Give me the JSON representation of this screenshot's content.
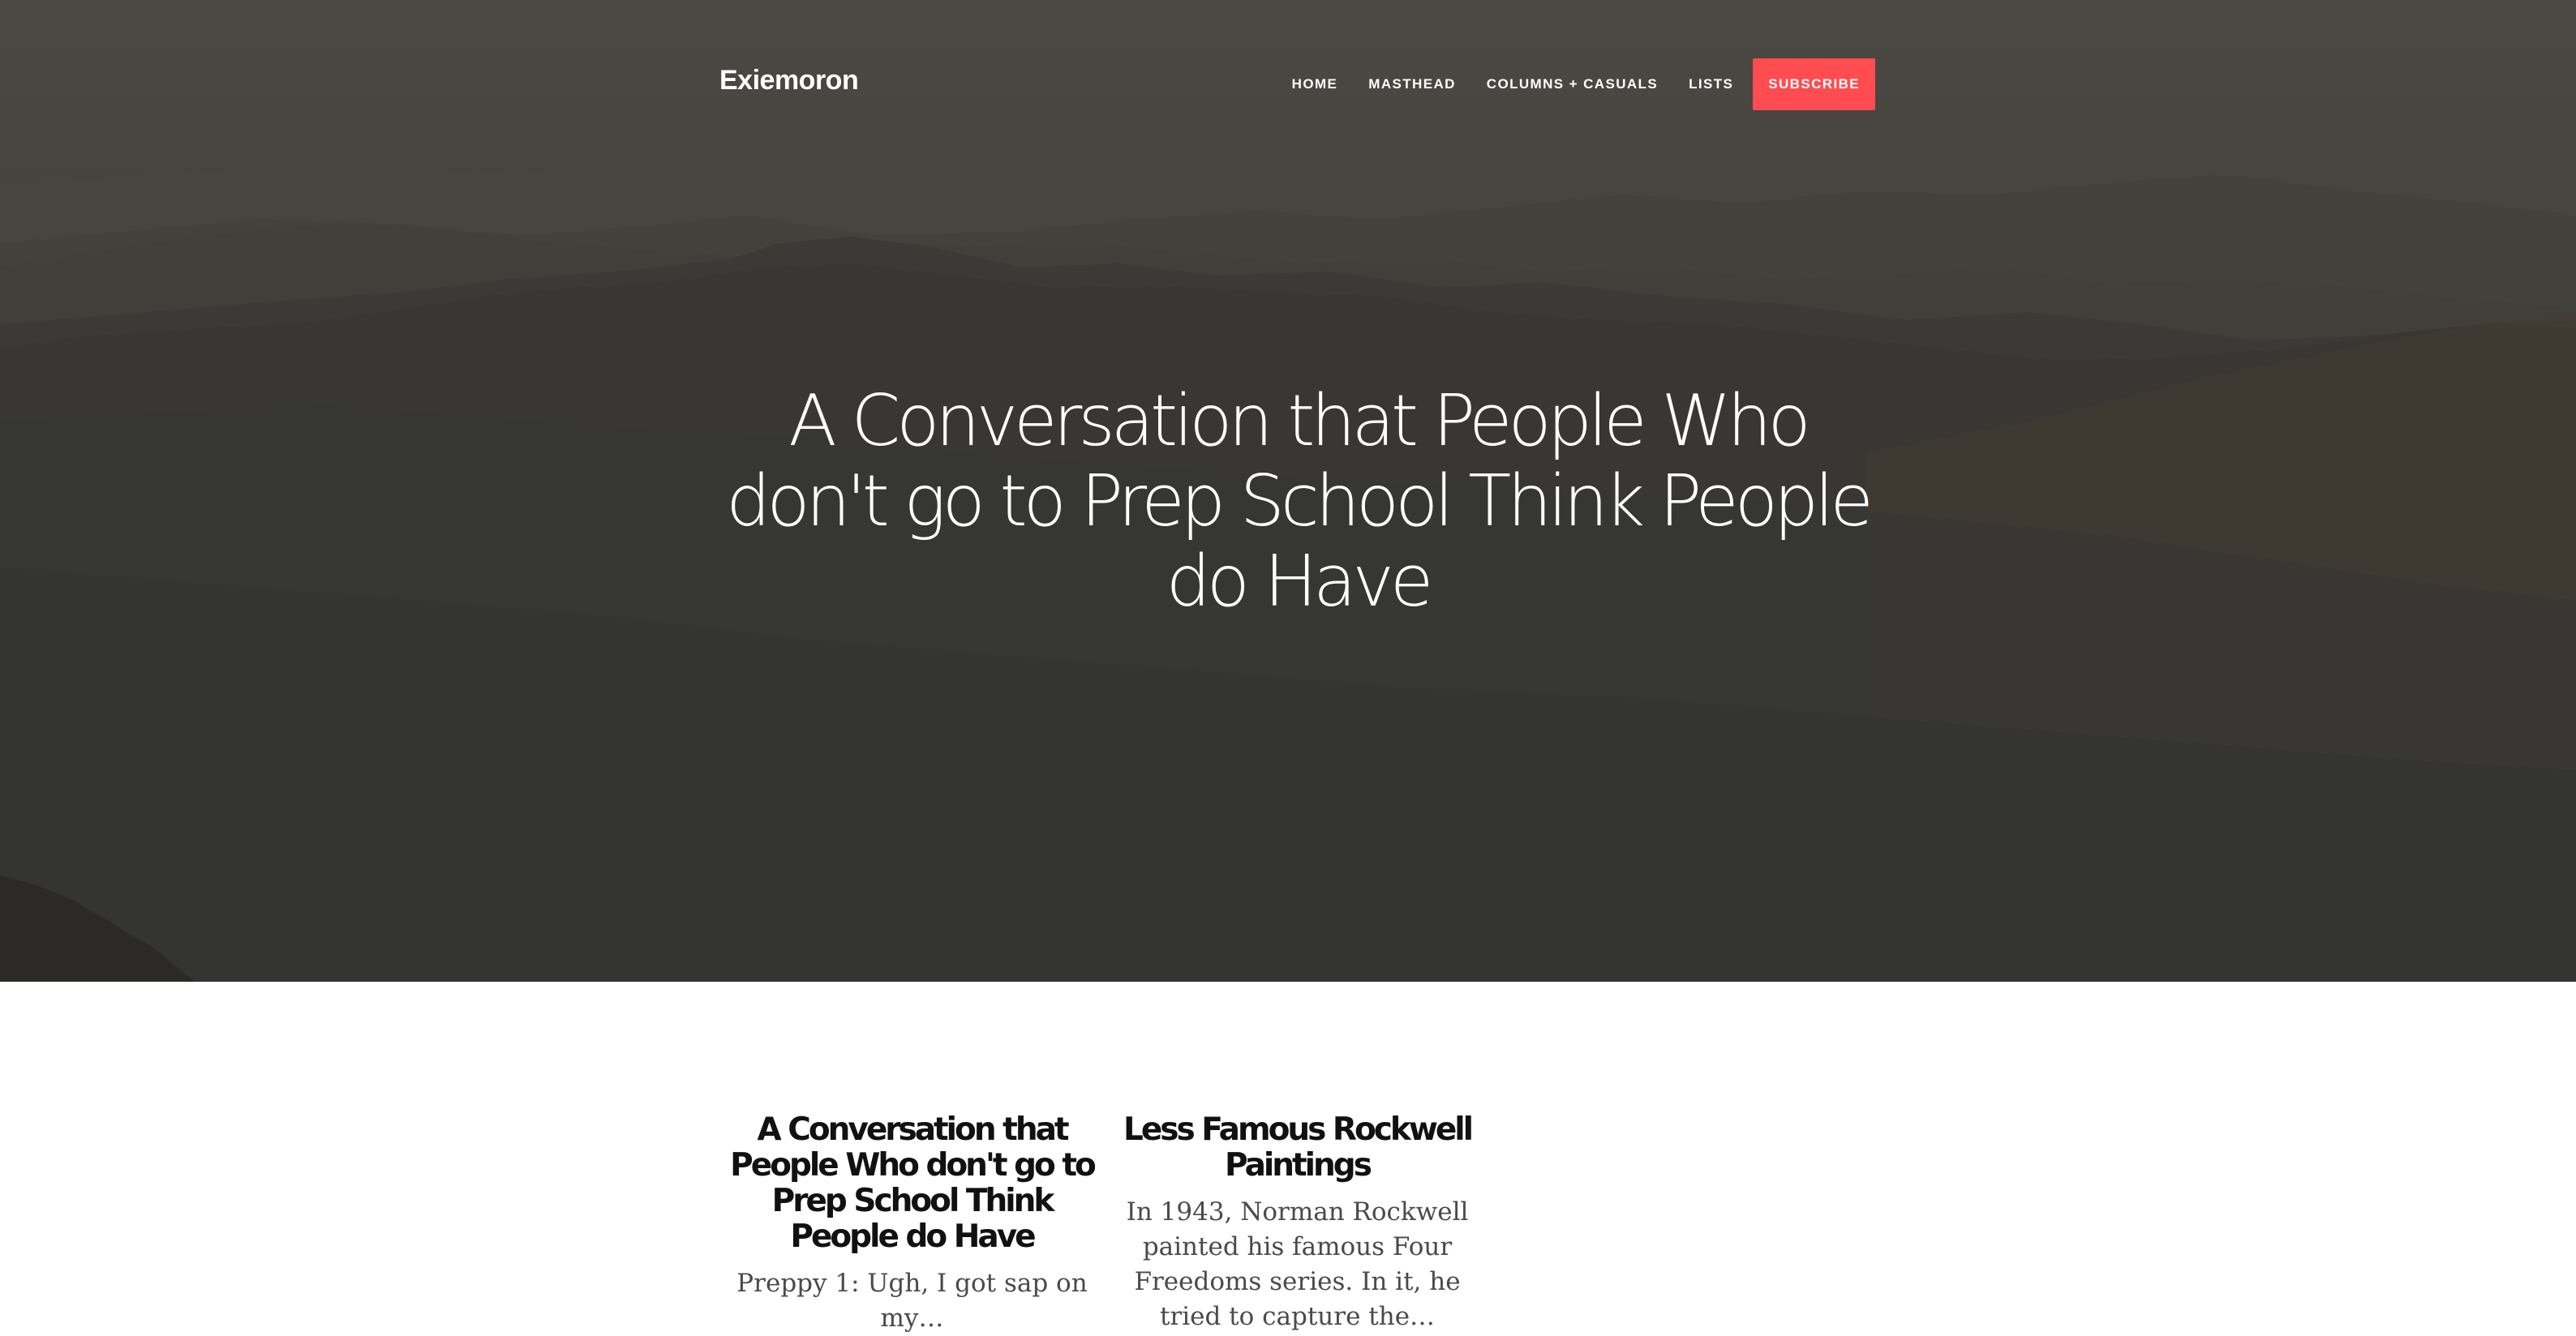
{
  "site": {
    "brand": "Exiemoron"
  },
  "nav": {
    "items": [
      {
        "label": "HOME"
      },
      {
        "label": "MASTHEAD"
      },
      {
        "label": "COLUMNS + CASUALS"
      },
      {
        "label": "LISTS"
      }
    ],
    "subscribe_label": "SUBSCRIBE"
  },
  "hero": {
    "title": "A Conversation that People Who don't go to Prep School Think People do Have"
  },
  "posts": [
    {
      "title": "A Conversation that People Who don't go to Prep School Think People do Have",
      "excerpt": "Preppy 1: Ugh, I got sap on my…"
    },
    {
      "title": "Less Famous Rockwell Paintings",
      "excerpt": "In 1943, Norman Rockwell painted his famous Four Freedoms series. In it, he tried to capture the…"
    }
  ],
  "colors": {
    "accent": "#ff4c50",
    "hero_bg": "#403e3c",
    "text_dark": "#111111",
    "text_body": "#4a4a4a"
  }
}
